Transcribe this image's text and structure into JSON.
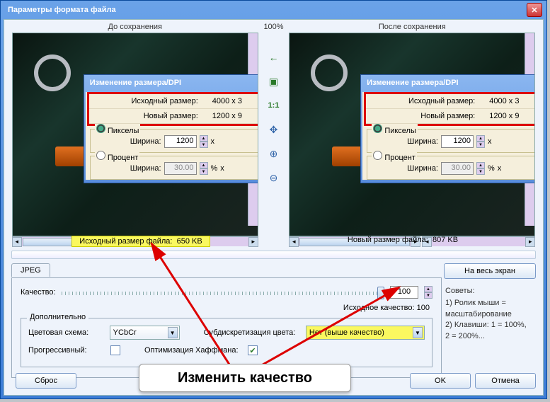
{
  "window": {
    "title": "Параметры формата файла"
  },
  "labels": {
    "before": "До сохранения",
    "after": "После сохранения",
    "zoom": "100%"
  },
  "dialog": {
    "title": "Изменение размера/DPI",
    "src_label": "Исходный размер:",
    "src_value": "4000 x 3",
    "new_label": "Новый размер:",
    "new_value": "1200 x 9",
    "pixels_label": "Пикселы",
    "percent_label": "Процент",
    "width_label": "Ширина:",
    "width_px": "1200",
    "width_pct": "30.00",
    "x": "x",
    "pct": "%"
  },
  "filesize": {
    "src_label": "Исходный размер файла:",
    "src_value": "650 KB",
    "new_label": "Новый размер файла:",
    "new_value": "807 KB"
  },
  "toolbar": {
    "back": "←",
    "fit": "▣",
    "onetoone": "1:1",
    "move": "✥",
    "zoomin": "🔍+",
    "zoomout": "🔍-"
  },
  "tabs": {
    "jpeg": "JPEG"
  },
  "quality": {
    "label": "Качество:",
    "value": "100",
    "orig_label": "Исходное качество:",
    "orig_value": "100"
  },
  "extra": {
    "legend": "Дополнительно",
    "colorscheme_label": "Цветовая схема:",
    "colorscheme_value": "YCbCr",
    "subsample_label": "Субдискретизация цвета:",
    "subsample_value": "Нет (выше качество)",
    "progressive_label": "Прогрессивный:",
    "huffman_label": "Оптимизация Хаффмана:"
  },
  "side": {
    "fullscreen": "На весь экран",
    "tips_head": "Советы:",
    "tip1_a": "1) Ролик мыши =",
    "tip1_b": "масштабирование",
    "tip2_a": "2) Клавиши: 1 = 100%,",
    "tip2_b": "2 = 200%..."
  },
  "buttons": {
    "reset": "Сброс",
    "ok": "OK",
    "cancel": "Отмена"
  },
  "annotation": "Изменить качество"
}
